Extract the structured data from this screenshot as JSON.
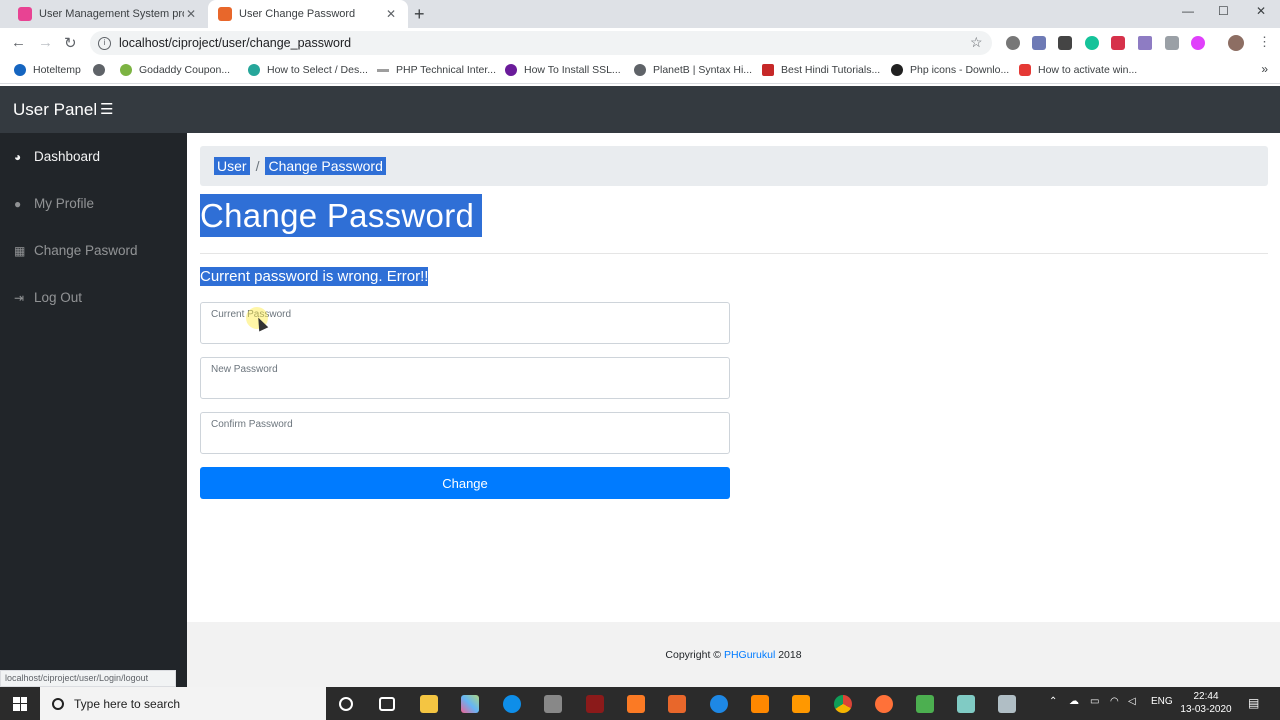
{
  "browser": {
    "tabs": [
      {
        "title": "User Management System proje",
        "active": false,
        "favicon_color": "#e84393"
      },
      {
        "title": "User Change Password",
        "active": true,
        "favicon_color": "#e8672b"
      }
    ],
    "address": "localhost/ciproject/user/change_password",
    "bookmarks": [
      {
        "label": "Hoteltemp",
        "color": "#1565c0"
      },
      {
        "label": "",
        "color": "#5f6368"
      },
      {
        "label": "Godaddy Coupon...",
        "color": "#7cb342"
      },
      {
        "label": "How to Select / Des...",
        "color": "#26a69a"
      },
      {
        "label": "PHP Technical Inter...",
        "color": "#9e9e9e"
      },
      {
        "label": "How To Install SSL...",
        "color": "#6a1b9a"
      },
      {
        "label": "PlanetB | Syntax Hi...",
        "color": "#5f6368"
      },
      {
        "label": "Best Hindi Tutorials...",
        "color": "#c62828"
      },
      {
        "label": "Php icons - Downlo...",
        "color": "#212121"
      },
      {
        "label": "How to activate win...",
        "color": "#e53935"
      }
    ],
    "status_url": "localhost/ciproject/user/Login/logout"
  },
  "app": {
    "brand": "User Panel",
    "sidebar": [
      {
        "label": "Dashboard",
        "icon": "dashboard-icon",
        "glyph": "◕",
        "active": true
      },
      {
        "label": "My Profile",
        "icon": "user-icon",
        "glyph": "●",
        "active": false
      },
      {
        "label": "Change Pasword",
        "icon": "table-icon",
        "glyph": "▦",
        "active": false
      },
      {
        "label": "Log Out",
        "icon": "signout-icon",
        "glyph": "⇥",
        "active": false
      }
    ],
    "breadcrumb": {
      "parent": "User",
      "separator": "/",
      "current": "Change Password"
    },
    "page_title": "Change Password",
    "alert": "Current password is wrong. Error!!",
    "form": {
      "current_password": {
        "label": "Current Password",
        "value": ""
      },
      "new_password": {
        "label": "New Password",
        "value": ""
      },
      "confirm_password": {
        "label": "Confirm Password",
        "value": ""
      },
      "submit": "Change"
    },
    "footer": {
      "prefix": "Copyright ©",
      "link": "PHGurukul",
      "year": "2018"
    }
  },
  "taskbar": {
    "search_placeholder": "Type here to search",
    "language": "ENG",
    "time": "22:44",
    "date": "13-03-2020"
  }
}
